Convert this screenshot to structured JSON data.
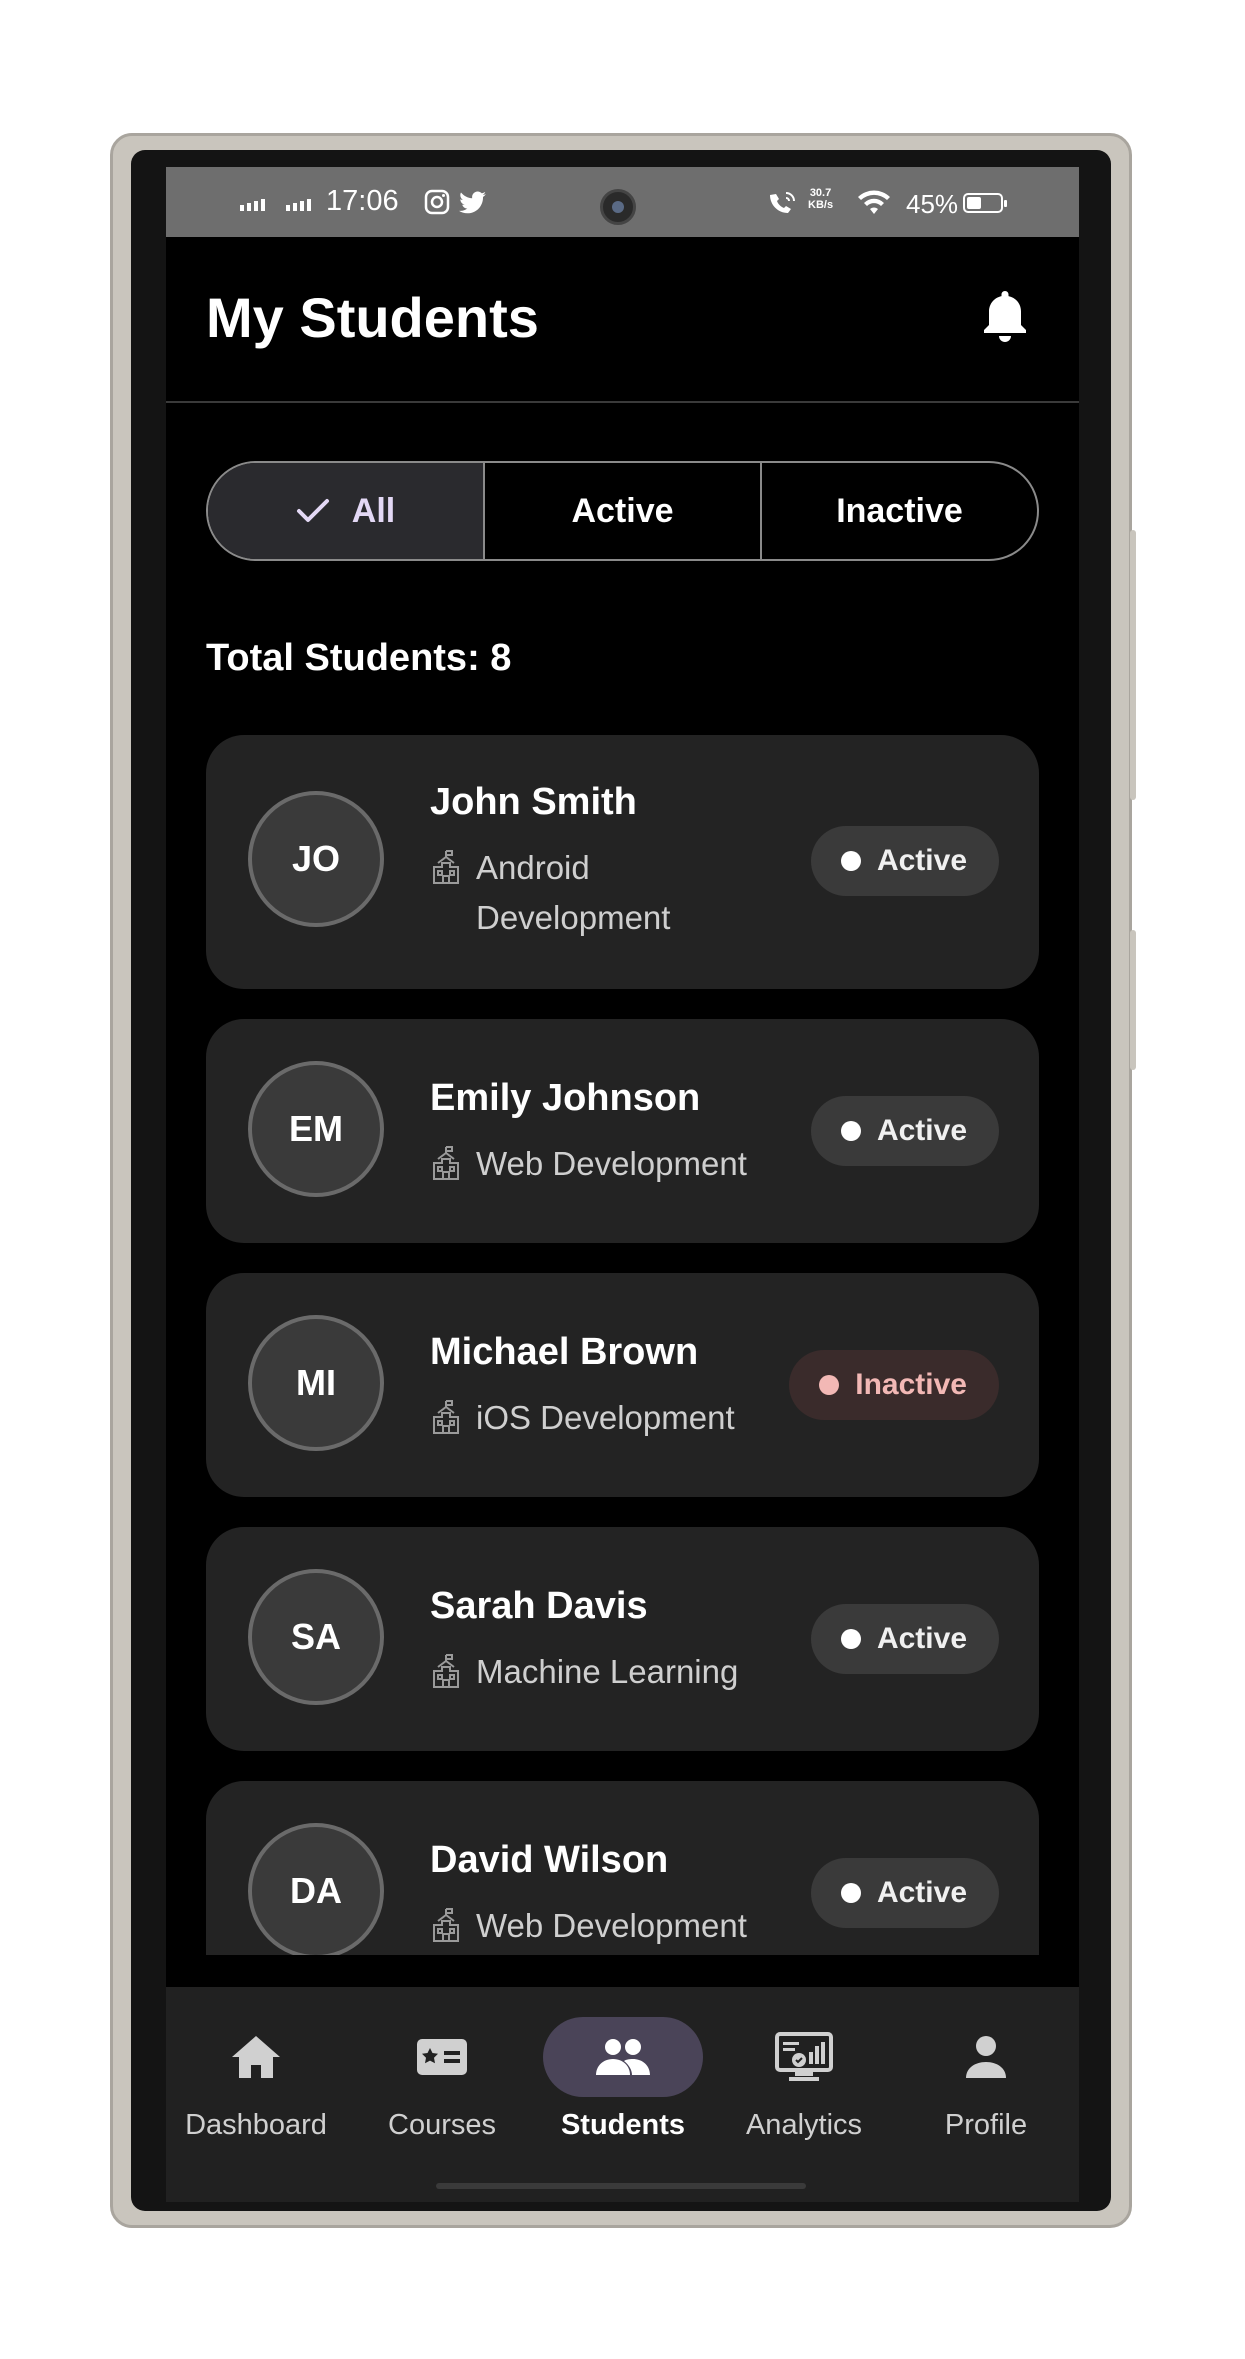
{
  "status_bar": {
    "time": "17:06",
    "speed_value": "30.7",
    "speed_unit": "KB/s",
    "battery": "45%"
  },
  "header": {
    "title": "My Students",
    "notification_icon": "bell-icon"
  },
  "filter": {
    "options": [
      "All",
      "Active",
      "Inactive"
    ],
    "selected": "All"
  },
  "total_label": "Total Students: 8",
  "students": [
    {
      "initials": "JO",
      "name": "John Smith",
      "course": "Android Development",
      "status": "Active"
    },
    {
      "initials": "EM",
      "name": "Emily Johnson",
      "course": "Web Development",
      "status": "Active"
    },
    {
      "initials": "MI",
      "name": "Michael Brown",
      "course": "iOS Development",
      "status": "Inactive"
    },
    {
      "initials": "SA",
      "name": "Sarah Davis",
      "course": "Machine Learning",
      "status": "Active"
    },
    {
      "initials": "DA",
      "name": "David Wilson",
      "course": "Web Development",
      "status": "Active"
    }
  ],
  "bottom_nav": {
    "items": [
      {
        "label": "Dashboard",
        "icon": "home-icon"
      },
      {
        "label": "Courses",
        "icon": "course-card-icon"
      },
      {
        "label": "Students",
        "icon": "students-icon"
      },
      {
        "label": "Analytics",
        "icon": "analytics-icon"
      },
      {
        "label": "Profile",
        "icon": "profile-icon"
      }
    ],
    "active": "Students"
  },
  "colors": {
    "background": "#000000",
    "card": "#232323",
    "accent_selected": "#4a4458",
    "inactive_text": "#f2b8b5"
  }
}
